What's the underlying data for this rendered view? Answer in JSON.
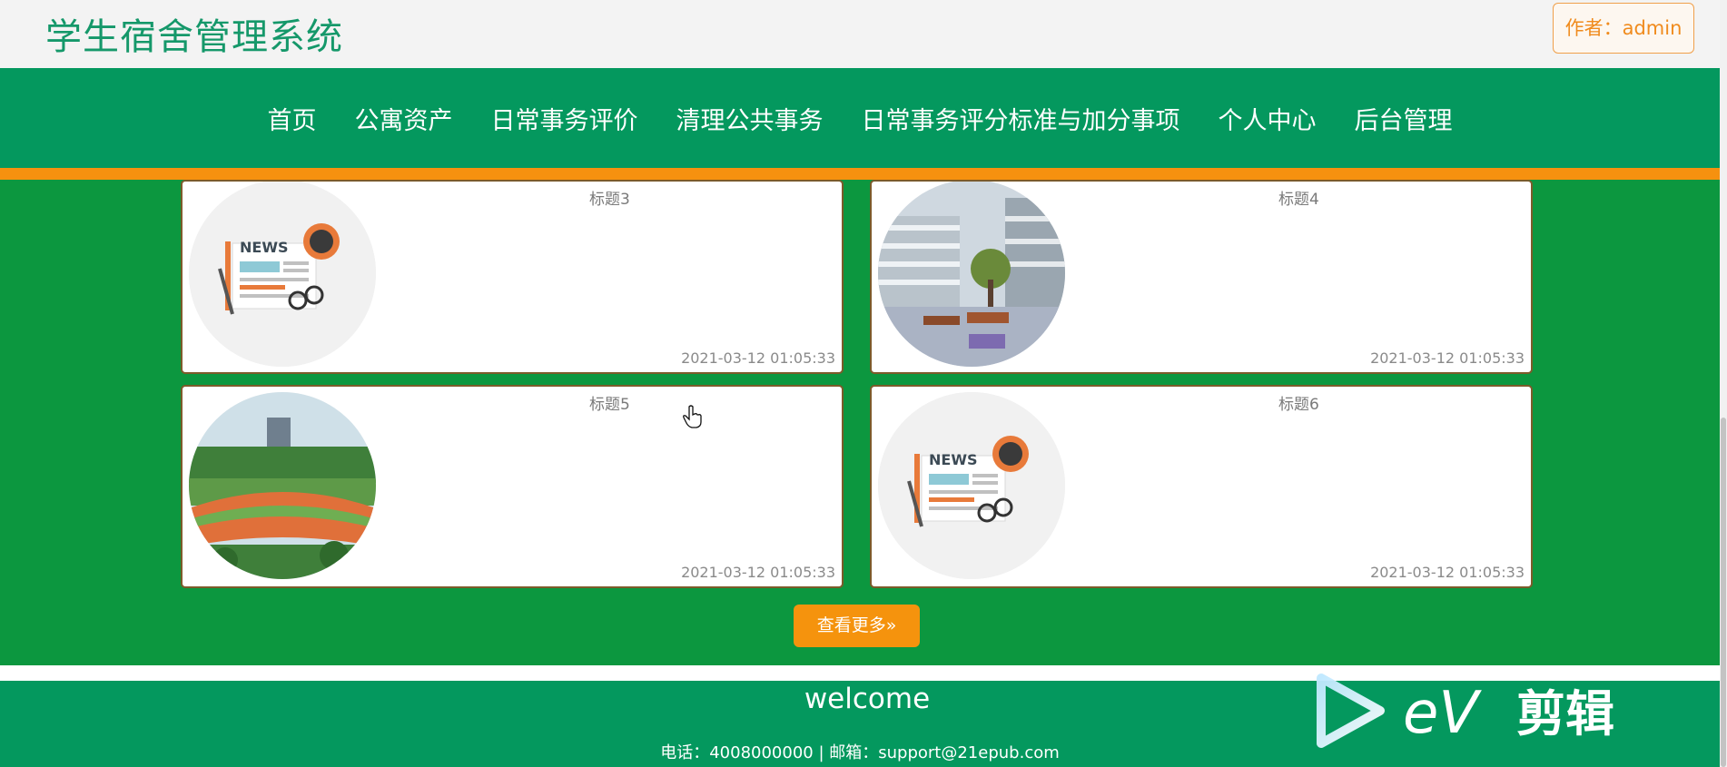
{
  "header": {
    "site_title": "学生宿舍管理系统",
    "author_label": "作者：admin"
  },
  "nav": {
    "items": [
      {
        "label": "首页"
      },
      {
        "label": "公寓资产"
      },
      {
        "label": "日常事务评价"
      },
      {
        "label": "清理公共事务"
      },
      {
        "label": "日常事务评分标准与加分事项"
      },
      {
        "label": "个人中心"
      },
      {
        "label": "后台管理"
      }
    ]
  },
  "cards": [
    {
      "title": "标题3",
      "date": "2021-03-12 01:05:33",
      "image": "news-illustration"
    },
    {
      "title": "标题4",
      "date": "2021-03-12 01:05:33",
      "image": "campus-building-photo"
    },
    {
      "title": "标题5",
      "date": "2021-03-12 01:05:33",
      "image": "sports-field-photo"
    },
    {
      "title": "标题6",
      "date": "2021-03-12 01:05:33",
      "image": "news-illustration"
    }
  ],
  "more_button": {
    "label": "查看更多»"
  },
  "footer": {
    "welcome": "welcome",
    "contact": "电话：4008000000 | 邮箱：support@21epub.com"
  },
  "watermark": {
    "text": "eV剪辑"
  },
  "colors": {
    "primary_green": "#04985e",
    "content_green": "#0c973f",
    "accent_orange": "#f6910f",
    "title_green": "#15986a"
  }
}
